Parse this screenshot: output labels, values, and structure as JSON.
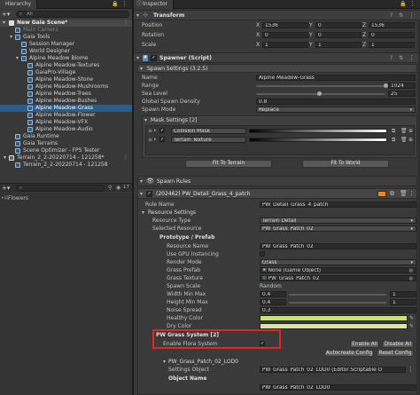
{
  "hierarchy": {
    "tab": "Hierarchy",
    "search_label": "All",
    "scene": "New Gaia Scene*",
    "items": [
      {
        "label": "Main Camera",
        "dim": true
      },
      {
        "label": "Gaia Tools",
        "dim": false
      },
      {
        "label": "Session Manager",
        "dim": false
      },
      {
        "label": "World Designer",
        "dim": false
      },
      {
        "label": "Alpine Meadow Biome",
        "dim": false
      },
      {
        "label": "Alpine Meadow-Textures",
        "dim": false
      },
      {
        "label": "GaiaPro-Village",
        "dim": false
      },
      {
        "label": "Alpine Meadow-Stone",
        "dim": false
      },
      {
        "label": "Alpine Meadow-Mushrooms",
        "dim": false
      },
      {
        "label": "Alpine Meadow-Trees",
        "dim": false
      },
      {
        "label": "Alpine Meadow-Bushes",
        "dim": false
      },
      {
        "label": "Alpine Meadow-Grass",
        "dim": false
      },
      {
        "label": "Alpine Meadow-Flower",
        "dim": false
      },
      {
        "label": "Alpine Meadow-VFX",
        "dim": false
      },
      {
        "label": "Alpine Meadow-Audio",
        "dim": false
      },
      {
        "label": "Gaia Runtime",
        "dim": false
      },
      {
        "label": "Gaia Terrains",
        "dim": false
      },
      {
        "label": "Scene Optimizer - FPS Tester",
        "dim": false
      },
      {
        "label": "Terrain_2_2-20220714 - 121258*",
        "dim": false
      },
      {
        "label": "Terrain_2_2-20220714 - 121258",
        "dim": false
      }
    ],
    "flowers_label": "Flowers",
    "count_badge": "17"
  },
  "inspector": {
    "tab": "Inspector",
    "transform": {
      "title": "Transform",
      "rows": [
        {
          "label": "Position",
          "x": "1536",
          "y": "0",
          "z": "1536"
        },
        {
          "label": "Rotation",
          "x": "0",
          "y": "0",
          "z": "0"
        },
        {
          "label": "Scale",
          "x": "1",
          "y": "1",
          "z": "1"
        }
      ],
      "axis_x": "X",
      "axis_y": "Y",
      "axis_z": "Z"
    },
    "spawner": {
      "title": "Spawner (Script)",
      "settings_title": "Spawn Settings (3.2.5)",
      "name_label": "Name",
      "name_value": "Alpine Meadow-Grass",
      "range_label": "Range",
      "range_value": "1024",
      "range_fraction": 1.0,
      "sea_label": "Sea Level",
      "sea_value": "25",
      "sea_fraction": 0.49,
      "density_label": "Global Spawn Density",
      "density_value": "0.8",
      "mode_label": "Spawn Mode",
      "mode_value": "Replace",
      "mask_title": "Mask Settings [2]",
      "masks": [
        "Collision Mask",
        "Terrain Texture"
      ],
      "fit_terrain": "Fit To Terrain",
      "fit_world": "Fit To World"
    },
    "spawn_rules": {
      "title": "Spawn Rules",
      "rule_title": "(202462) PW_Detail_Grass_4_patch",
      "rule_name_label": "Rule Name",
      "rule_name_value": "PW_Detail_Grass_4_patch",
      "resource_settings": "Resource Settings",
      "resource_type_label": "Resource Type",
      "resource_type_value": "Terrain Detail",
      "selected_resource_label": "Selected Resource",
      "selected_resource_value": "PW_Grass_Patch_02",
      "prototype_title": "Prototype / Prefab",
      "resource_name_label": "Resource Name",
      "resource_name_value": "PW_Grass_Patch_02",
      "gpu_label": "Use GPU Instancing",
      "render_label": "Render Mode",
      "render_value": "Grass",
      "prefab_label": "Grass Prefab",
      "prefab_value": "None (Game Object)",
      "texture_label": "Grass Texture",
      "texture_value": "PW_Grass_Patch_02",
      "scale_label": "Spawn Scale",
      "scale_value": "Random",
      "width_label": "Width Min Max",
      "width_min": "0.4",
      "width_max": "1",
      "height_label": "Height Min Max",
      "height_min": "0.4",
      "height_max": "1",
      "noise_label": "Noise Spread",
      "noise_value": "0.3",
      "healthy_label": "Healthy Color",
      "healthy_color": "#c8e07a",
      "dry_label": "Dry Color",
      "dry_color": "#dde4a0",
      "pw_grass_title": "PW Grass System [2]",
      "enable_all": "Enable All",
      "disable_all": "Disable All",
      "enable_flora_label": "Enable Flora System",
      "autocreate": "Autocreate Config",
      "reset_config": "Reset Config",
      "lod_title": "PW_Grass_Patch_02_LOD0",
      "settings_obj_label": "Settings Object",
      "settings_obj_value": "PW_Grass_Patch_02_LOD0 (Editor Scriptable O",
      "object_name_title": "Object Name",
      "object_name_value": "PW_Grass_Patch_02_LOD0"
    },
    "highlight_color": "#e0261f"
  }
}
